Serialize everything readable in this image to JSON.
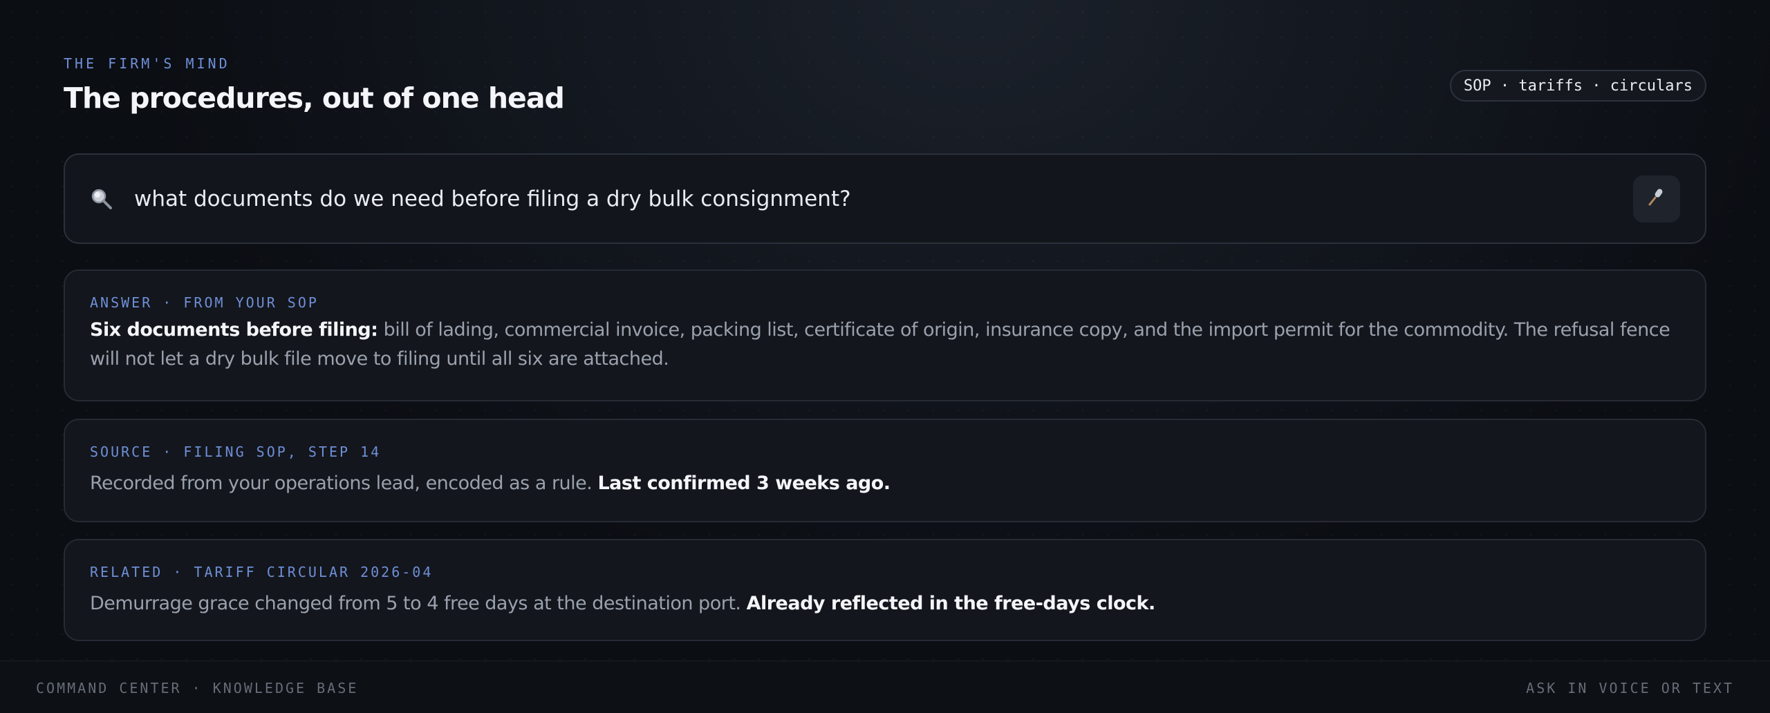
{
  "header": {
    "eyebrow": "THE FIRM'S MIND",
    "title": "The procedures, out of one head",
    "scope_pill": "SOP · tariffs · circulars"
  },
  "search": {
    "icon": "search-icon",
    "query": "what documents do we need before filing a dry bulk consignment?",
    "mic_icon": "microphone-icon"
  },
  "answer": {
    "label": "ANSWER · FROM YOUR SOP",
    "lead": "Six documents before filing:",
    "text": " bill of lading, commercial invoice, packing list, certificate of origin, insurance copy, and the import permit for the commodity. The refusal fence will not let a dry bulk file move to filing until all six are attached."
  },
  "source": {
    "label": "SOURCE · FILING SOP, STEP 14",
    "text": "Recorded from your operations lead, encoded as a rule. ",
    "emphasis": "Last confirmed 3 weeks ago."
  },
  "related": {
    "label": "RELATED · TARIFF CIRCULAR 2026-04",
    "text": "Demurrage grace changed from 5 to 4 free days at the destination port. ",
    "emphasis": "Already reflected in the free-days clock."
  },
  "footer": {
    "left": "COMMAND CENTER · KNOWLEDGE BASE",
    "right": "ASK IN VOICE OR TEXT"
  },
  "colors": {
    "background": "#0b0e13",
    "accent": "#6f8fd8",
    "text_primary": "#f3f5f9",
    "text_secondary": "#9aa1ad"
  }
}
